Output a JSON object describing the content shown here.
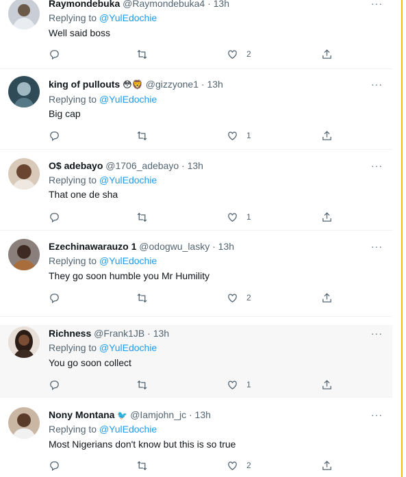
{
  "tweets": [
    {
      "name": "Raymondebuka",
      "badge": "",
      "handle": "@Raymondebuka4",
      "time": "· 13h",
      "replying_prefix": "Replying to ",
      "mention": "@YulEdochie",
      "text": "Well said boss",
      "likes": "2",
      "avatar_icon": "avatar-photo"
    },
    {
      "name": "king of pullouts",
      "badge": "😳🦁",
      "handle": "@gizzyone1",
      "time": "· 13h",
      "replying_prefix": "Replying to ",
      "mention": "@YulEdochie",
      "text": "Big cap",
      "likes": "1",
      "avatar_icon": "avatar-photo"
    },
    {
      "name": "O$ adebayo",
      "badge": "",
      "handle": "@1706_adebayo",
      "time": "· 13h",
      "replying_prefix": "Replying to ",
      "mention": "@YulEdochie",
      "text": "That one de sha",
      "likes": "1",
      "avatar_icon": "avatar-photo"
    },
    {
      "name": "Ezechinawarauzo 1",
      "badge": "",
      "handle": "@odogwu_lasky",
      "time": "· 13h",
      "replying_prefix": "Replying to ",
      "mention": "@YulEdochie",
      "text": "They go soon humble you Mr Humility",
      "likes": "2",
      "avatar_icon": "avatar-photo"
    },
    {
      "name": "Richness",
      "badge": "",
      "handle": "@Frank1JB",
      "time": "· 13h",
      "replying_prefix": "Replying to ",
      "mention": "@YulEdochie",
      "text": "You go soon collect",
      "likes": "1",
      "avatar_icon": "avatar-photo"
    },
    {
      "name": "Nony Montana",
      "badge": "🐦",
      "handle": "@Iamjohn_jc",
      "time": "· 13h",
      "replying_prefix": "Replying to ",
      "mention": "@YulEdochie",
      "text": "Most Nigerians don't know but this is so true",
      "likes": "2",
      "avatar_icon": "avatar-photo"
    }
  ],
  "more_label": "···",
  "colors": {
    "accent": "#1d9bf0",
    "muted": "#536471",
    "highlight_bg": "#f7f7f7",
    "side_line": "#f2c200"
  },
  "icons": [
    "reply-icon",
    "retweet-icon",
    "like-icon",
    "share-icon",
    "more-icon"
  ]
}
